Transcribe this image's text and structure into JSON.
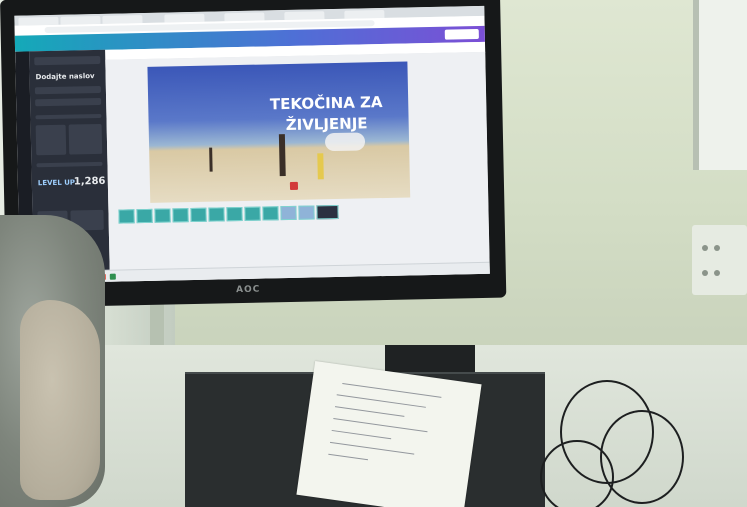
{
  "monitor": {
    "brand": "AOC"
  },
  "browser": {
    "tabs": [
      "",
      "",
      "",
      "",
      "",
      "",
      ""
    ],
    "toolbar": {
      "share_label": ""
    }
  },
  "canva": {
    "panel": {
      "heading": "Dodajte naslov",
      "number": "1,286",
      "level_up": "LEVEL UP"
    },
    "slide": {
      "title_line1": "TEKOČINA ZA",
      "title_line2": "ŽIVLJENJE"
    }
  }
}
